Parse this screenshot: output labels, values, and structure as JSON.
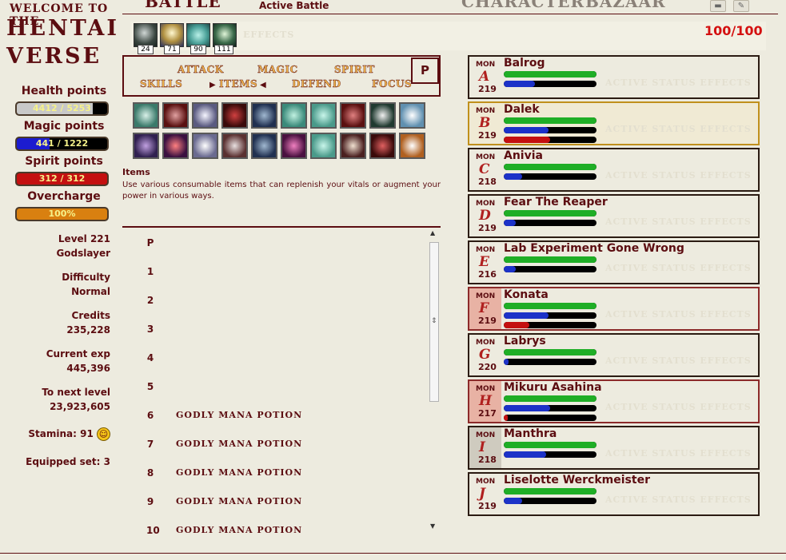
{
  "sidebar": {
    "logo_small": "WELCOME TO THE",
    "logo_line1": "HENTAI",
    "logo_line2": "VERSE",
    "vitals": [
      {
        "label": "Health points",
        "text": "4412 / 5253",
        "fraction": 0.84,
        "color": "#c8c8c8"
      },
      {
        "label": "Magic points",
        "text": "441 / 1222",
        "fraction": 0.36,
        "color": "#1c1cd0"
      },
      {
        "label": "Spirit points",
        "text": "312 / 312",
        "fraction": 1.0,
        "color": "#c41010"
      },
      {
        "label": "Overcharge",
        "text": "100%",
        "fraction": 1.0,
        "color": "#d98010"
      }
    ],
    "level": "Level 221",
    "title": "Godslayer",
    "difficulty_label": "Difficulty",
    "difficulty_value": "Normal",
    "credits_label": "Credits",
    "credits_value": "235,228",
    "exp_label": "Current exp",
    "exp_value": "445,396",
    "next_label": "To next level",
    "next_value": "23,923,605",
    "stamina": "Stamina: 91",
    "equipped": "Equipped set: 3"
  },
  "topnav": {
    "battle": "BATTLE",
    "active_battle": "Active Battle",
    "character": "CHARACTER",
    "bazaar": "BAZAAR"
  },
  "effects": {
    "counts": [
      "24",
      "71",
      "90",
      "111"
    ],
    "ghost_label": "EFFECTS",
    "turn_counter": "100/100"
  },
  "menu": {
    "attack": "ATTACK",
    "magic": "MAGIC",
    "spirit": "SPIRIT",
    "skills": "SKILLS",
    "items": "ITEMS",
    "defend": "DEFEND",
    "focus": "FOCUS",
    "p_button": "P"
  },
  "items": {
    "heading": "Items",
    "description": "Use various consumable items that can replenish your vitals or augment your power in various ways.",
    "rows": [
      {
        "key": "P",
        "name": ""
      },
      {
        "key": "1",
        "name": ""
      },
      {
        "key": "2",
        "name": ""
      },
      {
        "key": "3",
        "name": ""
      },
      {
        "key": "4",
        "name": ""
      },
      {
        "key": "5",
        "name": ""
      },
      {
        "key": "6",
        "name": "GODLY MANA POTION"
      },
      {
        "key": "7",
        "name": "GODLY MANA POTION"
      },
      {
        "key": "8",
        "name": "GODLY MANA POTION"
      },
      {
        "key": "9",
        "name": "GODLY MANA POTION"
      },
      {
        "key": "10",
        "name": "GODLY MANA POTION"
      }
    ]
  },
  "monsters": [
    {
      "tag": "MON",
      "letter": "A",
      "level": "219",
      "name": "Balrog",
      "hp": 1.0,
      "mp": 0.34,
      "sp": null,
      "state": "normal",
      "effects_label": "ACTIVE STATUS EFFECTS"
    },
    {
      "tag": "MON",
      "letter": "B",
      "level": "219",
      "name": "Dalek",
      "hp": 1.0,
      "mp": 0.48,
      "sp": 0.5,
      "state": "selected",
      "effects_label": "ACTIVE STATUS EFFECTS"
    },
    {
      "tag": "MON",
      "letter": "C",
      "level": "218",
      "name": "Anivia",
      "hp": 1.0,
      "mp": 0.2,
      "sp": null,
      "state": "normal",
      "effects_label": "ACTIVE STATUS EFFECTS"
    },
    {
      "tag": "MON",
      "letter": "D",
      "level": "219",
      "name": "Fear The Reaper",
      "hp": 1.0,
      "mp": 0.13,
      "sp": null,
      "state": "normal",
      "effects_label": "ACTIVE STATUS EFFECTS"
    },
    {
      "tag": "MON",
      "letter": "E",
      "level": "216",
      "name": "Lab Experiment Gone Wrong",
      "hp": 1.0,
      "mp": 0.13,
      "sp": null,
      "state": "normal",
      "effects_label": "ACTIVE STATUS EFFECTS"
    },
    {
      "tag": "MON",
      "letter": "F",
      "level": "219",
      "name": "Konata",
      "hp": 1.0,
      "mp": 0.48,
      "sp": 0.28,
      "state": "hilite",
      "effects_label": "ACTIVE STATUS EFFECTS"
    },
    {
      "tag": "MON",
      "letter": "G",
      "level": "220",
      "name": "Labrys",
      "hp": 1.0,
      "mp": 0.05,
      "sp": null,
      "state": "normal",
      "effects_label": "ACTIVE STATUS EFFECTS"
    },
    {
      "tag": "MON",
      "letter": "H",
      "level": "217",
      "name": "Mikuru Asahina",
      "hp": 1.0,
      "mp": 0.5,
      "sp": 0.04,
      "state": "hilite",
      "effects_label": "ACTIVE STATUS EFFECTS"
    },
    {
      "tag": "MON",
      "letter": "I",
      "level": "218",
      "name": "Manthra",
      "hp": 1.0,
      "mp": 0.46,
      "sp": null,
      "state": "grey",
      "effects_label": "ACTIVE STATUS EFFECTS"
    },
    {
      "tag": "MON",
      "letter": "J",
      "level": "219",
      "name": "Liselotte Werckmeister",
      "hp": 1.0,
      "mp": 0.2,
      "sp": null,
      "state": "normal",
      "effects_label": "ACTIVE STATUS EFFECTS"
    }
  ],
  "colors": {
    "hp": "#1fae26",
    "mp": "#1c32c8",
    "sp": "#c41010",
    "brand": "#5c0d11"
  }
}
